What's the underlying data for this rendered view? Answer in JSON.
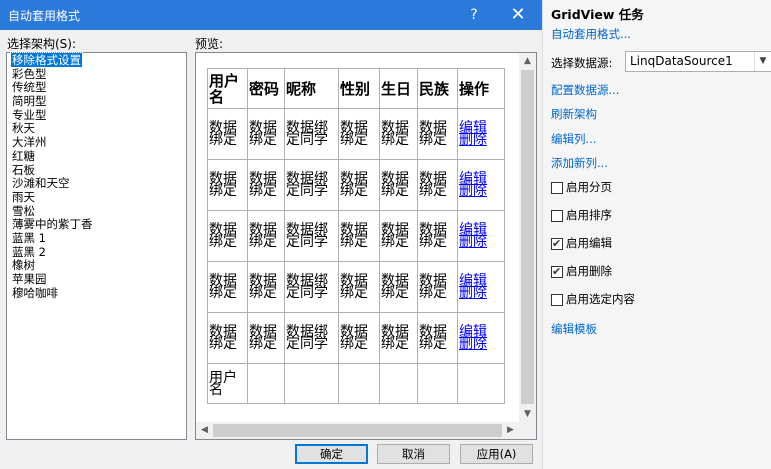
{
  "dialog": {
    "title": "自动套用格式",
    "help_label": "?",
    "close_label": "✕",
    "schemes_label": "选择架构(S):",
    "preview_label": "预览:",
    "schemes": [
      "移除格式设置",
      "彩色型",
      "传统型",
      "简明型",
      "专业型",
      "秋天",
      "大洋州",
      "红糖",
      "石板",
      "沙滩和天空",
      "雨天",
      "雪松",
      "薄雾中的紫丁香",
      "蓝黑 1",
      "蓝黑 2",
      "橡树",
      "苹果园",
      "穆哈咖啡"
    ],
    "selected_scheme_index": 0,
    "preview_grid": {
      "headers": [
        "用户名",
        "密码",
        "昵称",
        "性别",
        "生日",
        "民族",
        "操作"
      ],
      "row": [
        "数据绑定",
        "数据绑定",
        "数据绑定同学",
        "数据绑定",
        "数据绑定",
        "数据绑定"
      ],
      "edit_label": "编辑",
      "delete_label": "删除",
      "last_row_label": "用户名"
    },
    "buttons": {
      "ok": "确定",
      "cancel": "取消",
      "apply": "应用(A)"
    }
  },
  "tasks": {
    "title": "GridView 任务",
    "auto_format": "自动套用格式...",
    "datasource_label": "选择数据源:",
    "datasource_value": "LinqDataSource1",
    "configure": "配置数据源...",
    "refresh": "刷新架构",
    "edit_columns": "编辑列...",
    "add_column": "添加新列...",
    "options": [
      {
        "label": "启用分页",
        "checked": false
      },
      {
        "label": "启用排序",
        "checked": false
      },
      {
        "label": "启用编辑",
        "checked": true
      },
      {
        "label": "启用删除",
        "checked": true
      },
      {
        "label": "启用选定内容",
        "checked": false
      }
    ],
    "edit_templates": "编辑模板"
  }
}
